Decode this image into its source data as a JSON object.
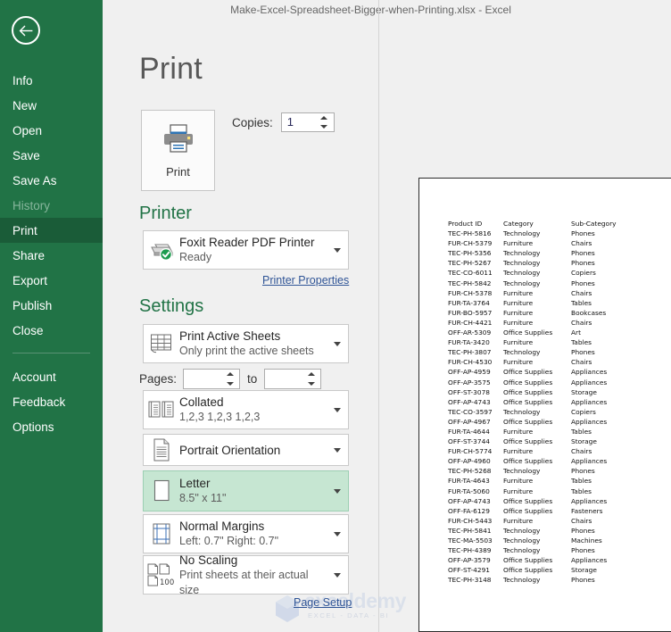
{
  "window": {
    "title": "Make-Excel-Spreadsheet-Bigger-when-Printing.xlsx  -  Excel"
  },
  "backstage": {
    "page_title": "Print",
    "back_icon": "back-arrow-icon"
  },
  "sidebar": {
    "items": [
      {
        "label": "Info",
        "state": "normal"
      },
      {
        "label": "New",
        "state": "normal"
      },
      {
        "label": "Open",
        "state": "normal"
      },
      {
        "label": "Save",
        "state": "normal"
      },
      {
        "label": "Save As",
        "state": "normal"
      },
      {
        "label": "History",
        "state": "disabled"
      },
      {
        "label": "Print",
        "state": "active"
      },
      {
        "label": "Share",
        "state": "normal"
      },
      {
        "label": "Export",
        "state": "normal"
      },
      {
        "label": "Publish",
        "state": "normal"
      },
      {
        "label": "Close",
        "state": "normal"
      }
    ],
    "bottom_items": [
      {
        "label": "Account"
      },
      {
        "label": "Feedback"
      },
      {
        "label": "Options"
      }
    ]
  },
  "print_action": {
    "label": "Print",
    "icon": "printer-icon"
  },
  "copies": {
    "label": "Copies:",
    "value": "1"
  },
  "printer": {
    "heading": "Printer",
    "info_icon": "info-icon",
    "name": "Foxit Reader PDF Printer",
    "status": "Ready",
    "icon": "printer-ready-icon",
    "properties_link": "Printer Properties"
  },
  "settings": {
    "heading": "Settings",
    "rows": [
      {
        "id": "print-area",
        "icon": "worksheet-icon",
        "title": "Print Active Sheets",
        "subtitle": "Only print the active sheets",
        "selected": false
      },
      {
        "id": "collation",
        "icon": "collate-icon",
        "title": "Collated",
        "subtitle": "1,2,3   1,2,3   1,2,3",
        "selected": false
      },
      {
        "id": "orientation",
        "icon": "portrait-page-icon",
        "title": "Portrait Orientation",
        "subtitle": "",
        "selected": false
      },
      {
        "id": "paper-size",
        "icon": "paper-icon",
        "title": "Letter",
        "subtitle": "8.5\" x 11\"",
        "selected": true
      },
      {
        "id": "margins",
        "icon": "margins-icon",
        "title": "Normal Margins",
        "subtitle": "Left:  0.7\"   Right:  0.7\"",
        "selected": false
      },
      {
        "id": "scaling",
        "icon": "scaling-icon",
        "title": "No Scaling",
        "subtitle": "Print sheets at their actual size",
        "selected": false
      }
    ],
    "scaling_badge": "100",
    "pages": {
      "label": "Pages:",
      "from_value": "",
      "to_label": "to",
      "to_value": ""
    },
    "page_setup_link": "Page Setup"
  },
  "preview": {
    "columns": [
      "Product ID",
      "Category",
      "Sub-Category"
    ],
    "rows": [
      [
        "TEC-PH-5816",
        "Technology",
        "Phones"
      ],
      [
        "FUR-CH-5379",
        "Furniture",
        "Chairs"
      ],
      [
        "TEC-PH-5356",
        "Technology",
        "Phones"
      ],
      [
        "TEC-PH-5267",
        "Technology",
        "Phones"
      ],
      [
        "TEC-CO-6011",
        "Technology",
        "Copiers"
      ],
      [
        "TEC-PH-5842",
        "Technology",
        "Phones"
      ],
      [
        "FUR-CH-5378",
        "Furniture",
        "Chairs"
      ],
      [
        "FUR-TA-3764",
        "Furniture",
        "Tables"
      ],
      [
        "FUR-BO-5957",
        "Furniture",
        "Bookcases"
      ],
      [
        "FUR-CH-4421",
        "Furniture",
        "Chairs"
      ],
      [
        "OFF-AR-5309",
        "Office Supplies",
        "Art"
      ],
      [
        "FUR-TA-3420",
        "Furniture",
        "Tables"
      ],
      [
        "TEC-PH-3807",
        "Technology",
        "Phones"
      ],
      [
        "FUR-CH-4530",
        "Furniture",
        "Chairs"
      ],
      [
        "OFF-AP-4959",
        "Office Supplies",
        "Appliances"
      ],
      [
        "OFF-AP-3575",
        "Office Supplies",
        "Appliances"
      ],
      [
        "OFF-ST-3078",
        "Office Supplies",
        "Storage"
      ],
      [
        "OFF-AP-4743",
        "Office Supplies",
        "Appliances"
      ],
      [
        "TEC-CO-3597",
        "Technology",
        "Copiers"
      ],
      [
        "OFF-AP-4967",
        "Office Supplies",
        "Appliances"
      ],
      [
        "FUR-TA-4644",
        "Furniture",
        "Tables"
      ],
      [
        "OFF-ST-3744",
        "Office Supplies",
        "Storage"
      ],
      [
        "FUR-CH-5774",
        "Furniture",
        "Chairs"
      ],
      [
        "OFF-AP-4960",
        "Office Supplies",
        "Appliances"
      ],
      [
        "TEC-PH-5268",
        "Technology",
        "Phones"
      ],
      [
        "FUR-TA-4643",
        "Furniture",
        "Tables"
      ],
      [
        "FUR-TA-5060",
        "Furniture",
        "Tables"
      ],
      [
        "OFF-AP-4743",
        "Office Supplies",
        "Appliances"
      ],
      [
        "OFF-FA-6129",
        "Office Supplies",
        "Fasteners"
      ],
      [
        "FUR-CH-5443",
        "Furniture",
        "Chairs"
      ],
      [
        "TEC-PH-5841",
        "Technology",
        "Phones"
      ],
      [
        "TEC-MA-5503",
        "Technology",
        "Machines"
      ],
      [
        "TEC-PH-4389",
        "Technology",
        "Phones"
      ],
      [
        "OFF-AP-3579",
        "Office Supplies",
        "Appliances"
      ],
      [
        "OFF-ST-4291",
        "Office Supplies",
        "Storage"
      ],
      [
        "TEC-PH-3148",
        "Technology",
        "Phones"
      ]
    ]
  },
  "watermark": {
    "text": "exceldemy",
    "subtitle": "EXCEL - DATA - BI"
  },
  "colors": {
    "brand_green": "#217346",
    "active_green": "#1a5c38",
    "selection_green": "#c6e6d2",
    "link_blue": "#2f5496"
  }
}
